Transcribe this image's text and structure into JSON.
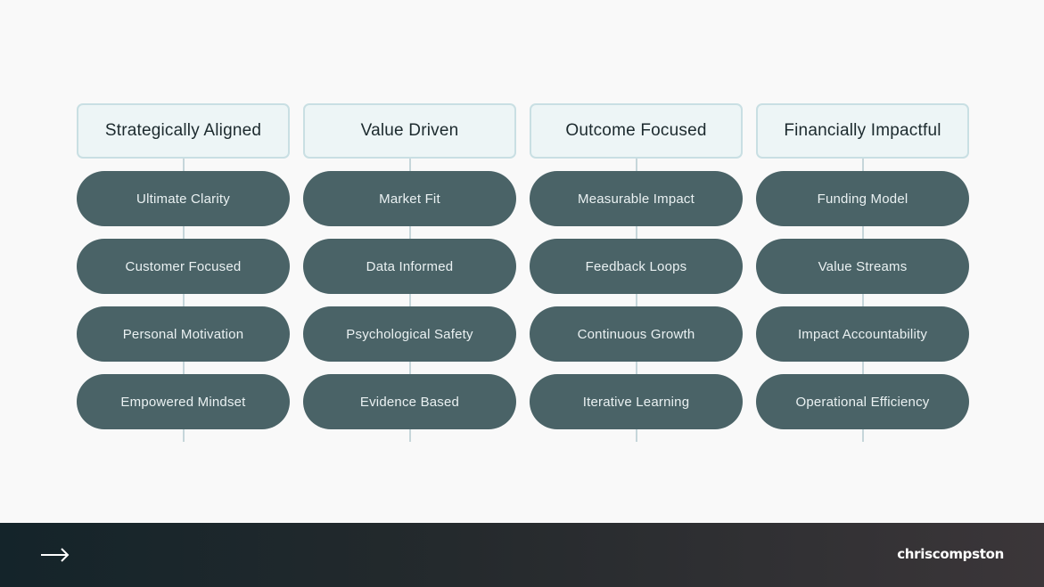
{
  "diagram": {
    "columns": [
      {
        "header": "Strategically Aligned",
        "items": [
          "Ultimate Clarity",
          "Customer Focused",
          "Personal Motivation",
          "Empowered Mindset"
        ]
      },
      {
        "header": "Value Driven",
        "items": [
          "Market Fit",
          "Data Informed",
          "Psychological Safety",
          "Evidence Based"
        ]
      },
      {
        "header": "Outcome Focused",
        "items": [
          "Measurable Impact",
          "Feedback Loops",
          "Continuous Growth",
          "Iterative Learning"
        ]
      },
      {
        "header": "Financially Impactful",
        "items": [
          "Funding Model",
          "Value Streams",
          "Impact Accountability",
          "Operational Efficiency"
        ]
      }
    ]
  },
  "footer": {
    "nav_icon": "arrow-right-icon",
    "brand": "chriscompston"
  },
  "colors": {
    "background": "#f9f9f9",
    "header_fill": "#edf5f6",
    "header_border": "#c9dfe3",
    "pill_fill": "#4a6367",
    "pill_text": "#eaf1f2",
    "connector": "#c6d6da",
    "footer_start": "#14242a",
    "footer_end": "#3b3639"
  }
}
